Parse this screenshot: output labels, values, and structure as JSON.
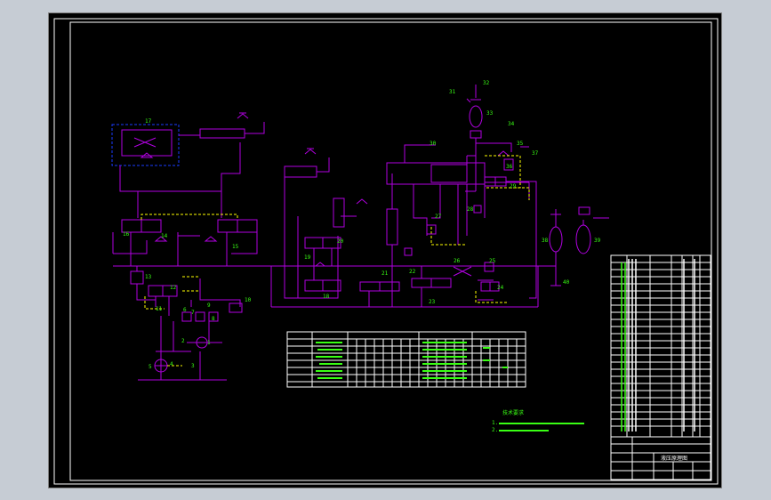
{
  "canvas": {
    "background": "#c6ccd4",
    "sheet_color": "#000000",
    "line_color": "#b000e0",
    "label_color": "#39ff14",
    "frame_color": "#ffffff",
    "pilot_color": "#ffff00",
    "group_color": "#1a3cff"
  },
  "drawing": {
    "title": "液压原理图",
    "components": {
      "c1": "1",
      "c2": "2",
      "c3": "3",
      "c4": "4",
      "c5": "5",
      "c6": "6",
      "c7": "7",
      "c8": "8",
      "c9": "9",
      "c10": "10",
      "c11": "11",
      "c12": "12",
      "c13": "13",
      "c14": "14",
      "c15": "15",
      "c16": "16",
      "c17": "17",
      "c18": "18",
      "c19": "19",
      "c20": "20",
      "c21": "21",
      "c22": "22",
      "c23": "23",
      "c24": "24",
      "c25": "25",
      "c26": "26",
      "c27": "27",
      "c28": "28",
      "c29": "29",
      "c30": "30",
      "c31": "31",
      "c32": "32",
      "c33": "33",
      "c34": "34",
      "c35": "35",
      "c36": "36",
      "c37": "37",
      "c38": "38",
      "c39": "39",
      "c40": "40"
    },
    "notes": {
      "heading": "技术要求",
      "line1": "1.",
      "line2": "2."
    }
  }
}
